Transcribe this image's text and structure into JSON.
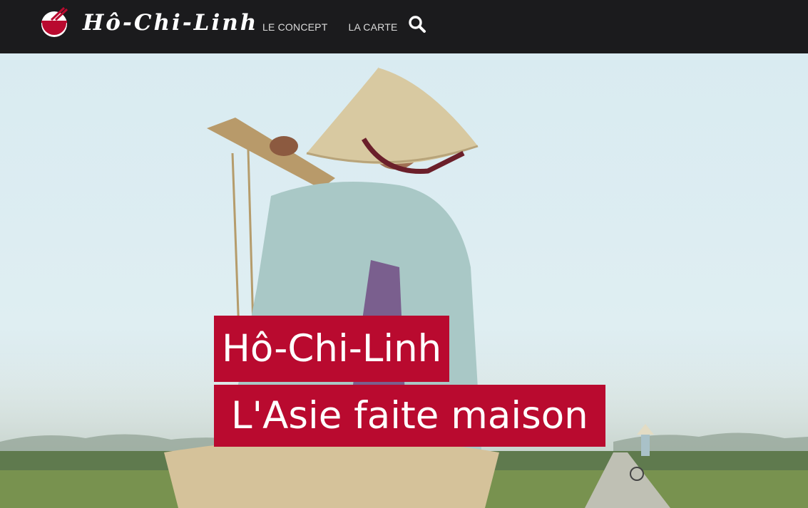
{
  "header": {
    "brand": "Hô-Chi-Linh",
    "nav": [
      "LE CONCEPT",
      "LA CARTE"
    ],
    "search_icon": "search-icon"
  },
  "hero": {
    "title_line1": "Hô-Chi-Linh",
    "title_line2": "L'Asie faite maison",
    "image": "photo of a vietnamese woman in a conical hat carrying a yoke in rice fields"
  },
  "colors": {
    "topbar": "#1b1b1d",
    "accent": "#b90a2f",
    "text": "#ffffff"
  }
}
